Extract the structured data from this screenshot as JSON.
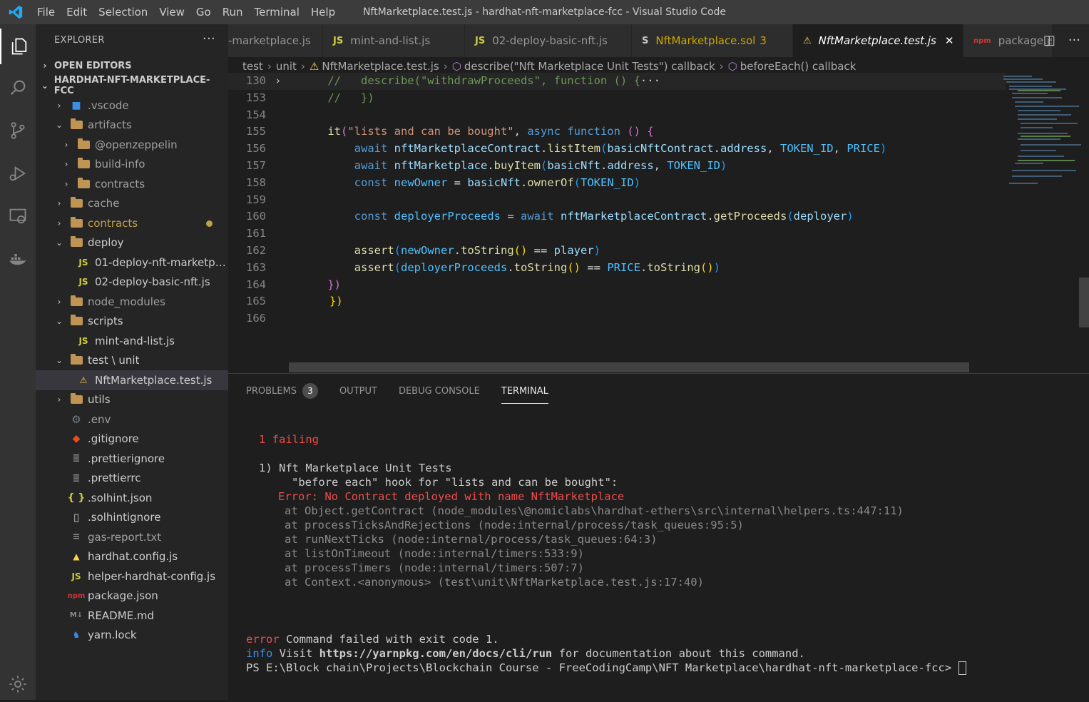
{
  "window_title": "NftMarketplace.test.js - hardhat-nft-marketplace-fcc - Visual Studio Code",
  "menu": [
    "File",
    "Edit",
    "Selection",
    "View",
    "Go",
    "Run",
    "Terminal",
    "Help"
  ],
  "sidebar": {
    "header": "EXPLORER",
    "more": "···",
    "open_editors": "OPEN EDITORS",
    "project": "HARDHAT-NFT-MARKETPLACE-FCC",
    "items": [
      {
        "label": ".vscode",
        "chev": "›",
        "icon": "vscode-folder"
      },
      {
        "label": "artifacts",
        "chev": "⌄",
        "icon": "folder"
      },
      {
        "label": "@openzeppelin",
        "chev": "›",
        "icon": "folder"
      },
      {
        "label": "build-info",
        "chev": "›",
        "icon": "folder"
      },
      {
        "label": "contracts",
        "chev": "›",
        "icon": "folder"
      },
      {
        "label": "cache",
        "chev": "›",
        "icon": "folder"
      },
      {
        "label": "contracts",
        "chev": "›",
        "icon": "folder"
      },
      {
        "label": "deploy",
        "chev": "⌄",
        "icon": "folder"
      },
      {
        "label": "01-deploy-nft-marketpl...",
        "icon": "js"
      },
      {
        "label": "02-deploy-basic-nft.js",
        "icon": "js"
      },
      {
        "label": "node_modules",
        "chev": "›",
        "icon": "folder"
      },
      {
        "label": "scripts",
        "chev": "⌄",
        "icon": "folder"
      },
      {
        "label": "mint-and-list.js",
        "icon": "js"
      },
      {
        "label": "test \\ unit",
        "chev": "⌄",
        "icon": "folder"
      },
      {
        "label": "NftMarketplace.test.js",
        "icon": "test"
      },
      {
        "label": "utils",
        "chev": "›",
        "icon": "folder"
      },
      {
        "label": ".env",
        "icon": "gear"
      },
      {
        "label": ".gitignore",
        "icon": "git"
      },
      {
        "label": ".prettierignore",
        "icon": "prettier"
      },
      {
        "label": ".prettierrc",
        "icon": "prettier"
      },
      {
        "label": ".solhint.json",
        "icon": "json"
      },
      {
        "label": ".solhintignore",
        "icon": "file"
      },
      {
        "label": "gas-report.txt",
        "icon": "txt"
      },
      {
        "label": "hardhat.config.js",
        "icon": "hardhat"
      },
      {
        "label": "helper-hardhat-config.js",
        "icon": "js"
      },
      {
        "label": "package.json",
        "icon": "npm"
      },
      {
        "label": "README.md",
        "icon": "md"
      },
      {
        "label": "yarn.lock",
        "icon": "yarn"
      }
    ]
  },
  "tabs": [
    {
      "label": "-marketplace.js",
      "icon": ""
    },
    {
      "label": "mint-and-list.js",
      "icon": "JS"
    },
    {
      "label": "02-deploy-basic-nft.js",
      "icon": "JS"
    },
    {
      "label": "NftMarketplace.sol",
      "icon": "S",
      "badge": "3"
    },
    {
      "label": "NftMarketplace.test.js",
      "icon": "⚠",
      "close": "✕"
    },
    {
      "label": "package.js",
      "icon": "npm"
    }
  ],
  "breadcrumb": [
    "test",
    "unit",
    "NftMarketplace.test.js",
    "describe(\"Nft Marketplace Unit Tests\") callback",
    "beforeEach() callback"
  ],
  "code": {
    "line_numbers": [
      "130",
      "153",
      "154",
      "155",
      "156",
      "157",
      "158",
      "159",
      "160",
      "161",
      "162",
      "163",
      "164",
      "165",
      "166"
    ],
    "fold_marker": "›"
  },
  "panel": {
    "tabs": [
      "PROBLEMS",
      "OUTPUT",
      "DEBUG CONSOLE",
      "TERMINAL"
    ],
    "problems_count": "3"
  },
  "terminal": {
    "failing": "1 failing",
    "test_name": "1) Nft Marketplace Unit Tests",
    "hook": "\"before each\" hook for \"lists and can be bought\":",
    "error": "Error: No Contract deployed with name NftMarketplace",
    "stack": [
      "at Object.getContract (node_modules\\@nomiclabs\\hardhat-ethers\\src\\internal\\helpers.ts:447:11)",
      "at processTicksAndRejections (node:internal/process/task_queues:95:5)",
      "at runNextTicks (node:internal/process/task_queues:64:3)",
      "at listOnTimeout (node:internal/timers:533:9)",
      "at processTimers (node:internal/timers:507:7)",
      "at Context.<anonymous> (test\\unit\\NftMarketplace.test.js:17:40)"
    ],
    "error_word": "error",
    "error_msg": " Command failed with exit code 1.",
    "info_word": "info",
    "info_pre": " Visit ",
    "info_url": "https://yarnpkg.com/en/docs/cli/run",
    "info_post": " for documentation about this command.",
    "prompt": "PS E:\\Block chain\\Projects\\Blockchain Course - FreeCodingCamp\\NFT Marketplace\\hardhat-nft-marketplace-fcc> "
  },
  "colors": {
    "accent": "#007acc",
    "error": "#f14c4c",
    "js_icon": "#cbcb41",
    "folder": "#c09553"
  }
}
